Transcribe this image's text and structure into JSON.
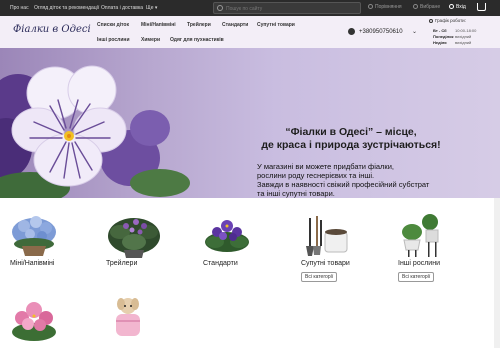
{
  "topbar": {
    "links": [
      "Про нас",
      "Огляд діток та рекомендації",
      "Оплата і доставка",
      "Ще"
    ],
    "search_placeholder": "Пошук по сайту",
    "compare": "Порівняння",
    "favorites": "Вибране",
    "login": "Вхід"
  },
  "header": {
    "logo": "Фіалки в Одесі",
    "nav_row1": [
      "Списки діток",
      "Міні/Напівміні",
      "Трейлери",
      "Стандарти",
      "Супутні товари"
    ],
    "nav_row2": [
      "Інші рослини",
      "Химери",
      "Одяг для пухнастиків"
    ],
    "phone": "+380950750610",
    "schedule_title": "Графік роботи:",
    "schedule": [
      {
        "days": "Вт - Сб",
        "hours": "10:00-18:00"
      },
      {
        "days": "Понеділок",
        "hours": "вихідний"
      },
      {
        "days": "Неділя",
        "hours": "вихідний"
      }
    ]
  },
  "hero": {
    "title_lines": [
      "“Фіалки в Одесі” – місце,",
      "де краса і природа зустрічаються!"
    ],
    "text_lines": [
      "У магазині ви можете придбати фіалки,",
      "рослини роду геснерієвих та інші.",
      "Завжди в наявності свіжий професійний субстрат",
      "та інші супутні товари."
    ]
  },
  "categories": [
    {
      "label": "Міні/Напівміні",
      "button": "",
      "icon": "violet-pot-icon"
    },
    {
      "label": "Трейлери",
      "button": "",
      "icon": "trailer-plant-icon"
    },
    {
      "label": "Стандарти",
      "button": "",
      "icon": "standard-violet-icon"
    },
    {
      "label": "Супутні товари",
      "button": "Всі категорії",
      "icon": "garden-tools-icon"
    },
    {
      "label": "Інші рослини",
      "button": "Всі категорії",
      "icon": "house-plants-icon"
    },
    {
      "label": "",
      "button": "",
      "icon": "pink-violet-icon"
    },
    {
      "label": "",
      "button": "",
      "icon": "dog-clothes-icon"
    }
  ],
  "colors": {
    "topbar": "#2b2b2b",
    "header": "#f3eef7",
    "hero": "#b7a7cf",
    "petal": "#f4f0fa",
    "petal_vein": "#6a4d98"
  }
}
